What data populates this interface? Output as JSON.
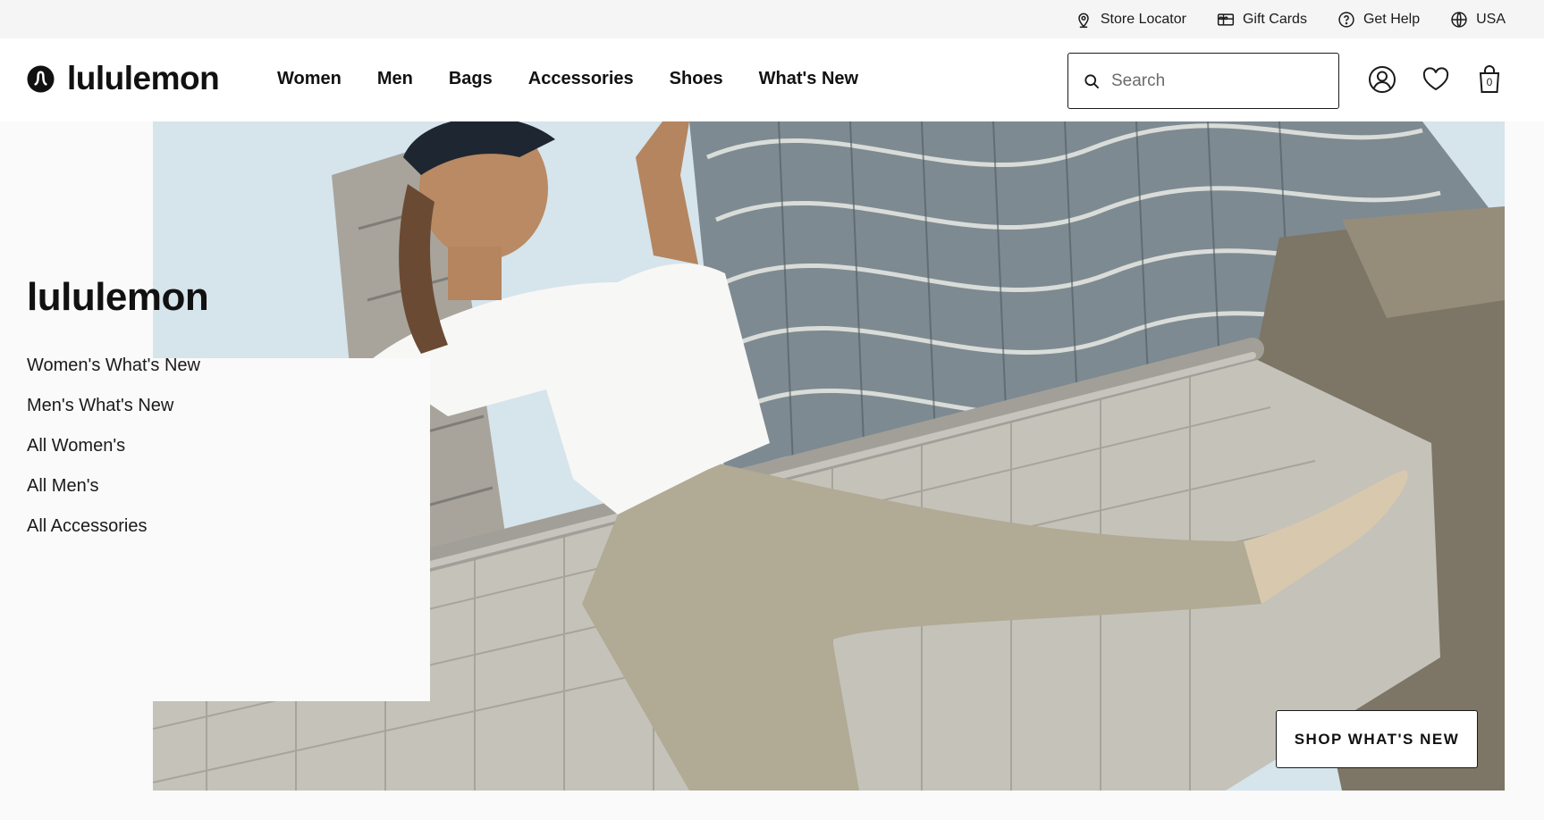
{
  "utility": {
    "items": [
      {
        "label": "Store Locator",
        "icon": "map-pin-icon"
      },
      {
        "label": "Gift Cards",
        "icon": "gift-card-icon"
      },
      {
        "label": "Get Help",
        "icon": "help-circle-icon"
      },
      {
        "label": "USA",
        "icon": "globe-icon"
      }
    ]
  },
  "brand": {
    "wordmark": "lululemon",
    "logo_icon": "lululemon-logo-icon"
  },
  "nav": {
    "items": [
      "Women",
      "Men",
      "Bags",
      "Accessories",
      "Shoes",
      "What's New"
    ]
  },
  "search": {
    "placeholder": "Search",
    "value": "",
    "icon": "search-icon"
  },
  "header_actions": {
    "account_icon": "account-icon",
    "wishlist_icon": "heart-icon",
    "bag_icon": "shopping-bag-icon",
    "bag_count": "0"
  },
  "hero": {
    "title": "lululemon",
    "links": [
      "Women's What's New",
      "Men's What's New",
      "All Women's",
      "All Men's",
      "All Accessories"
    ],
    "cta_label": "SHOP WHAT'S NEW"
  },
  "colors": {
    "text": "#1a1a1a",
    "utility_bg": "#f5f5f5",
    "page_bg": "#fafafa",
    "header_bg": "#ffffff"
  }
}
